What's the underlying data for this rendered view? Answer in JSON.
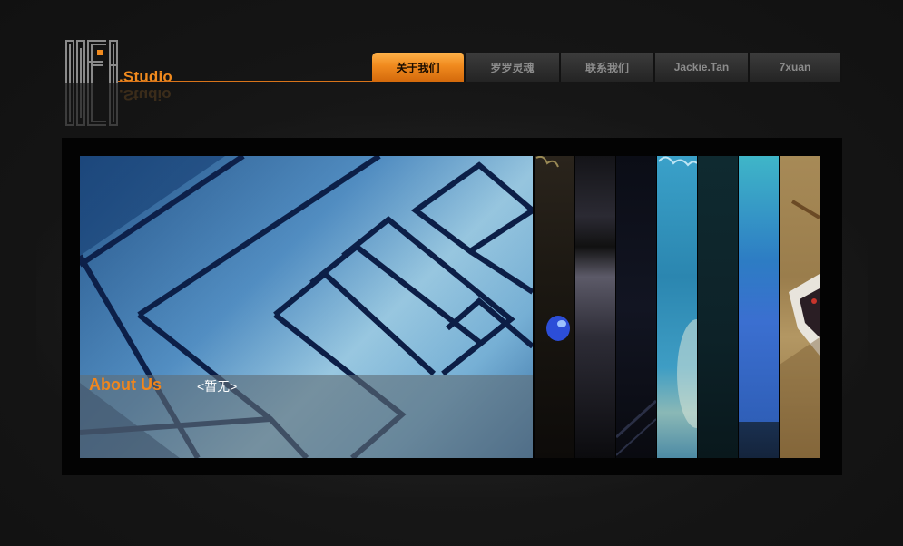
{
  "header": {
    "logo_text": ".Studio",
    "logo_mark": "MEA-monogram"
  },
  "nav": {
    "items": [
      {
        "label": "关于我们",
        "active": true
      },
      {
        "label": "罗罗灵魂",
        "active": false
      },
      {
        "label": "联系我们",
        "active": false
      },
      {
        "label": "Jackie.Tan",
        "active": false
      },
      {
        "label": "7xuan",
        "active": false
      }
    ]
  },
  "hero": {
    "title": "About Us",
    "text": "<暂无>"
  },
  "thumbnails": {
    "count": 7
  },
  "colors": {
    "accent": "#f08a1e",
    "background": "#141414",
    "frame": "#030303"
  }
}
